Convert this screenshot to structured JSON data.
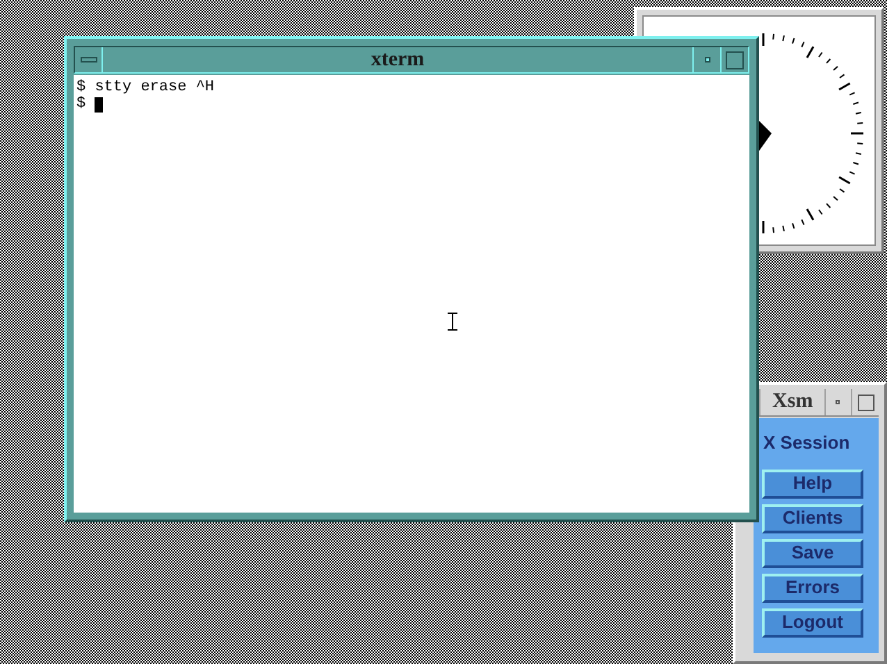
{
  "xsm": {
    "title": "Xsm",
    "heading": "X Session",
    "buttons": [
      "Help",
      "Clients",
      "Save",
      "Errors",
      "Logout"
    ]
  },
  "xterm": {
    "title": "xterm",
    "lines": [
      {
        "text": "$ stty erase ^H",
        "cursor": false
      },
      {
        "text": "$ ",
        "cursor": true
      }
    ]
  }
}
